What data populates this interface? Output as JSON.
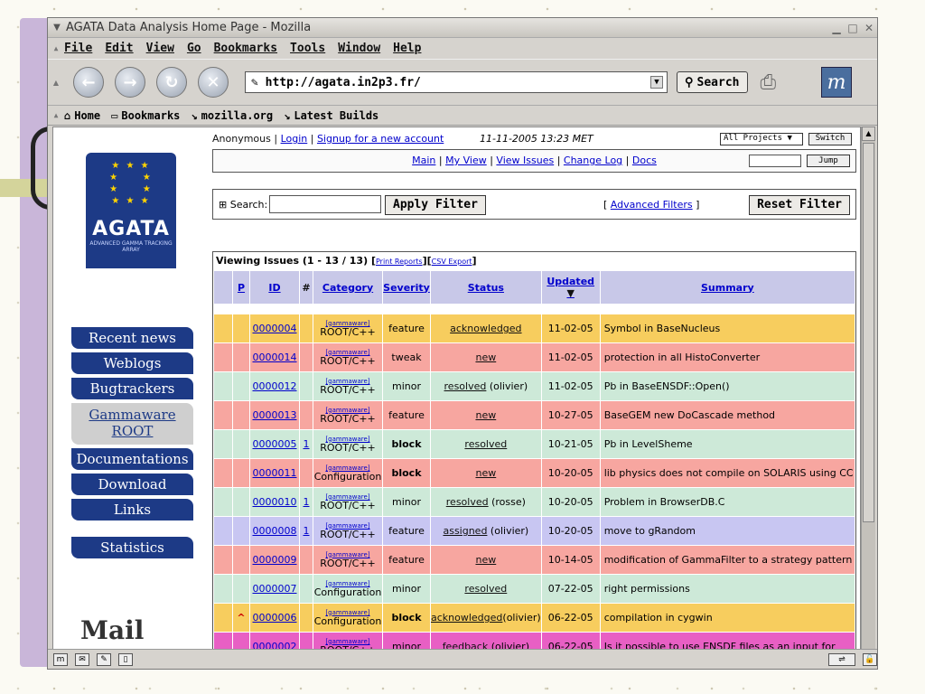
{
  "window": {
    "title": "AGATA Data Analysis Home Page - Mozilla",
    "menu": [
      "File",
      "Edit",
      "View",
      "Go",
      "Bookmarks",
      "Tools",
      "Window",
      "Help"
    ],
    "url": "http://agata.in2p3.fr/",
    "search_label": "Search",
    "personal_bar": [
      "Home",
      "Bookmarks",
      "mozilla.org",
      "Latest Builds"
    ]
  },
  "page": {
    "logo": {
      "wordmark": "AGATA",
      "sub": "ADVANCED GAMMA TRACKING ARRAY"
    },
    "sidenav": [
      "Recent news",
      "Weblogs",
      "Bugtrackers",
      "Gammaware ROOT",
      "Documentations",
      "Download",
      "Links",
      "Statistics"
    ],
    "mail": "Mail",
    "topline": {
      "user": "Anonymous",
      "login": "Login",
      "signup": "Signup for a new account",
      "date": "11-11-2005 13:23 MET"
    },
    "project_select": "All Projects",
    "switch_label": "Switch",
    "jump_label": "Jump",
    "menu_links": [
      "Main",
      "My View",
      "View Issues",
      "Change Log",
      "Docs"
    ],
    "filter": {
      "search_label": "Search:",
      "apply": "Apply Filter",
      "advanced": "Advanced Filters",
      "reset": "Reset Filter"
    },
    "viewing": "Viewing Issues (1 - 13 / 13)",
    "print_reports": "Print Reports",
    "csv_export": "CSV Export",
    "columns": [
      "P",
      "ID",
      "#",
      "Category",
      "Severity",
      "Status",
      "Updated",
      "Summary"
    ],
    "issues": [
      {
        "prio": "",
        "id": "0000004",
        "notes": "",
        "tag": "[gammaware]",
        "cat": "ROOT/C++",
        "sev": "feature",
        "status": "acknowledged",
        "who": "",
        "updated": "11-02-05",
        "summary": "Symbol in BaseNucleus",
        "color": "#f7cd5e"
      },
      {
        "prio": "",
        "id": "0000014",
        "notes": "",
        "tag": "[gammaware]",
        "cat": "ROOT/C++",
        "sev": "tweak",
        "status": "new",
        "who": "",
        "updated": "11-02-05",
        "summary": "protection in all HistoConverter",
        "color": "#f7a6a0"
      },
      {
        "prio": "",
        "id": "0000012",
        "notes": "",
        "tag": "[gammaware]",
        "cat": "ROOT/C++",
        "sev": "minor",
        "status": "resolved",
        "who": " (olivier)",
        "updated": "11-02-05",
        "summary": "Pb in BaseENSDF::Open()",
        "color": "#cde9d8"
      },
      {
        "prio": "",
        "id": "0000013",
        "notes": "",
        "tag": "[gammaware]",
        "cat": "ROOT/C++",
        "sev": "feature",
        "status": "new",
        "who": "",
        "updated": "10-27-05",
        "summary": "BaseGEM new DoCascade method",
        "color": "#f7a6a0"
      },
      {
        "prio": "",
        "id": "0000005",
        "notes": "1",
        "tag": "[gammaware]",
        "cat": "ROOT/C++",
        "sev": "block",
        "status": "resolved",
        "who": "",
        "updated": "10-21-05",
        "summary": "Pb in LevelSheme",
        "color": "#cde9d8"
      },
      {
        "prio": "",
        "id": "0000011",
        "notes": "",
        "tag": "[gammaware]",
        "cat": "Configuration",
        "sev": "block",
        "status": "new",
        "who": "",
        "updated": "10-20-05",
        "summary": "lib physics does not compile on SOLARIS using CC",
        "color": "#f7a6a0"
      },
      {
        "prio": "",
        "id": "0000010",
        "notes": "1",
        "tag": "[gammaware]",
        "cat": "ROOT/C++",
        "sev": "minor",
        "status": "resolved",
        "who": " (rosse)",
        "updated": "10-20-05",
        "summary": "Problem in BrowserDB.C",
        "color": "#cde9d8"
      },
      {
        "prio": "",
        "id": "0000008",
        "notes": "1",
        "tag": "[gammaware]",
        "cat": "ROOT/C++",
        "sev": "feature",
        "status": "assigned",
        "who": " (olivier)",
        "updated": "10-20-05",
        "summary": "move to gRandom",
        "color": "#c8c6f2"
      },
      {
        "prio": "",
        "id": "0000009",
        "notes": "",
        "tag": "[gammaware]",
        "cat": "ROOT/C++",
        "sev": "feature",
        "status": "new",
        "who": "",
        "updated": "10-14-05",
        "summary": "modification of GammaFilter to a strategy pattern",
        "color": "#f7a6a0"
      },
      {
        "prio": "",
        "id": "0000007",
        "notes": "",
        "tag": "[gammaware]",
        "cat": "Configuration",
        "sev": "minor",
        "status": "resolved",
        "who": "",
        "updated": "07-22-05",
        "summary": "right permissions",
        "color": "#cde9d8"
      },
      {
        "prio": "^",
        "id": "0000006",
        "notes": "",
        "tag": "[gammaware]",
        "cat": "Configuration",
        "sev": "block",
        "status": "acknowledged",
        "who": "(olivier)",
        "updated": "06-22-05",
        "summary": "compilation in cygwin",
        "color": "#f7cd5e"
      },
      {
        "prio": "",
        "id": "0000002",
        "notes": "",
        "tag": "[gammaware]",
        "cat": "ROOT/C++",
        "sev": "minor",
        "status": "feedback",
        "who": " (olivier)",
        "updated": "06-22-05",
        "summary": "Is it possible to use ENSDF files as an input for",
        "color": "#e85fc4"
      }
    ]
  }
}
